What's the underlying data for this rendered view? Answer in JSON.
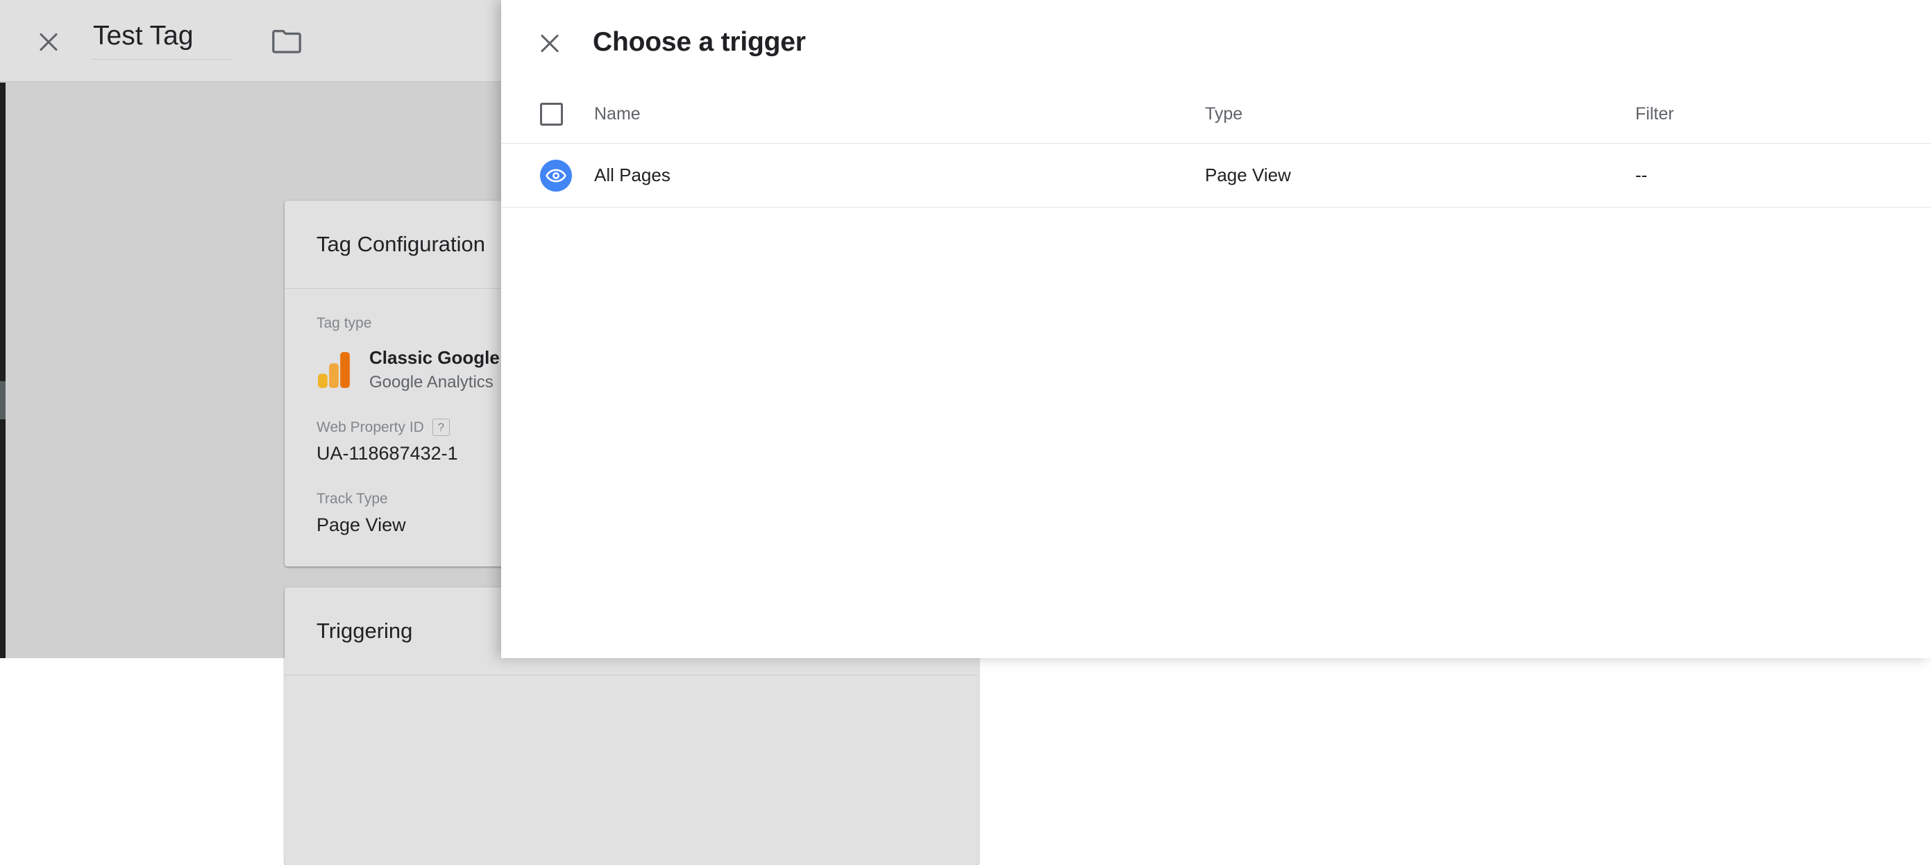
{
  "tag_editor": {
    "close_label": "close-icon",
    "tag_name": "Test Tag",
    "folder_icon": "folder-icon",
    "tag_configuration": {
      "title": "Tag Configuration",
      "tag_type_label": "Tag type",
      "tag_type_name": "Classic Google Analytics",
      "tag_type_vendor": "Google Analytics",
      "web_property_id_label": "Web Property ID",
      "web_property_id_help": "?",
      "web_property_id_value": "UA-118687432-1",
      "track_type_label": "Track Type",
      "track_type_value": "Page View"
    },
    "triggering": {
      "title": "Triggering"
    }
  },
  "modal": {
    "close_label": "close-icon",
    "title": "Choose a trigger",
    "table": {
      "headers": {
        "name": "Name",
        "type": "Type",
        "filter": "Filter"
      },
      "rows": [
        {
          "icon": "page-view-eye-icon",
          "name": "All Pages",
          "type": "Page View",
          "filter": "--"
        }
      ]
    }
  },
  "colors": {
    "accent_blue": "#4285f4",
    "ga_orange": "#e8710a",
    "ga_yellow": "#f9ab00",
    "app_background": "#d0d0d0",
    "card_background": "#e1e1e1",
    "header_background": "#e0e0e0",
    "text_primary": "#202124",
    "text_secondary": "#5f6368",
    "text_muted": "#80868b"
  }
}
